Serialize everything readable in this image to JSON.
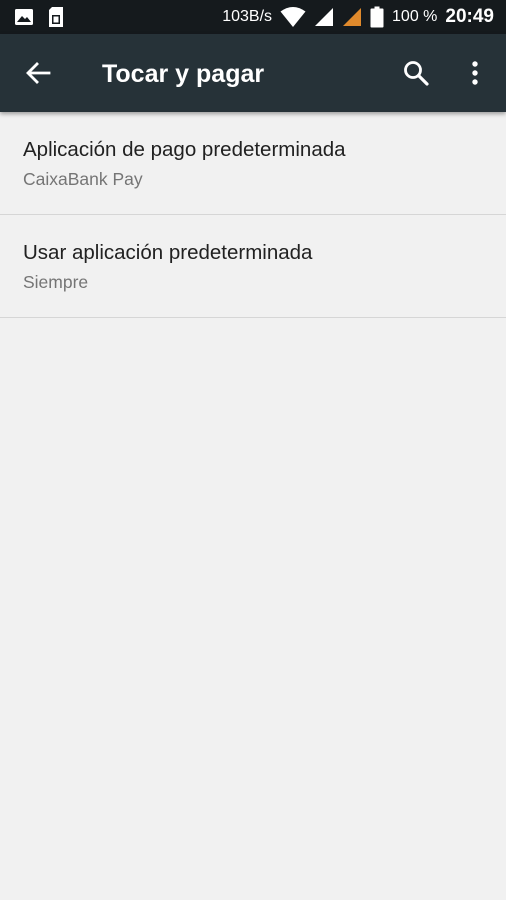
{
  "status_bar": {
    "network_speed": "103B/s",
    "battery_percent": "100 %",
    "time": "20:49",
    "icons": [
      "image-icon",
      "sim-card-icon",
      "wifi-icon",
      "signal-icon",
      "signal-secondary-icon",
      "battery-icon"
    ],
    "accent_signal_color": "#e08a2c"
  },
  "toolbar": {
    "title": "Tocar y pagar",
    "background_color": "#263238",
    "icons": [
      "back-arrow-icon",
      "search-icon",
      "more-vert-icon"
    ]
  },
  "settings": {
    "items": [
      {
        "title": "Aplicación de pago predeterminada",
        "summary": "CaixaBank Pay"
      },
      {
        "title": "Usar aplicación predeterminada",
        "summary": "Siempre"
      }
    ]
  }
}
